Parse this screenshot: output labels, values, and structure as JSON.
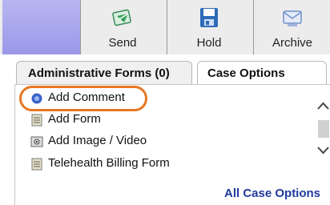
{
  "toolbar": {
    "buttons": [
      {
        "label": "Send",
        "icon": "send-icon"
      },
      {
        "label": "Hold",
        "icon": "save-disk-icon"
      },
      {
        "label": "Archive",
        "icon": "archive-icon"
      }
    ]
  },
  "tabs": [
    {
      "label": "Administrative Forms (0)",
      "active": false
    },
    {
      "label": "Case Options",
      "active": true
    }
  ],
  "case_options": {
    "items": [
      {
        "label": "Add Comment",
        "icon": "comment-icon"
      },
      {
        "label": "Add Form",
        "icon": "form-icon"
      },
      {
        "label": "Add Image / Video",
        "icon": "image-icon"
      },
      {
        "label": "Telehealth Billing Form",
        "icon": "form-icon"
      }
    ],
    "all_link": "All Case Options"
  },
  "colors": {
    "highlight": "#e87722",
    "link": "#1f3a9e",
    "accent": "#9a98e8"
  }
}
